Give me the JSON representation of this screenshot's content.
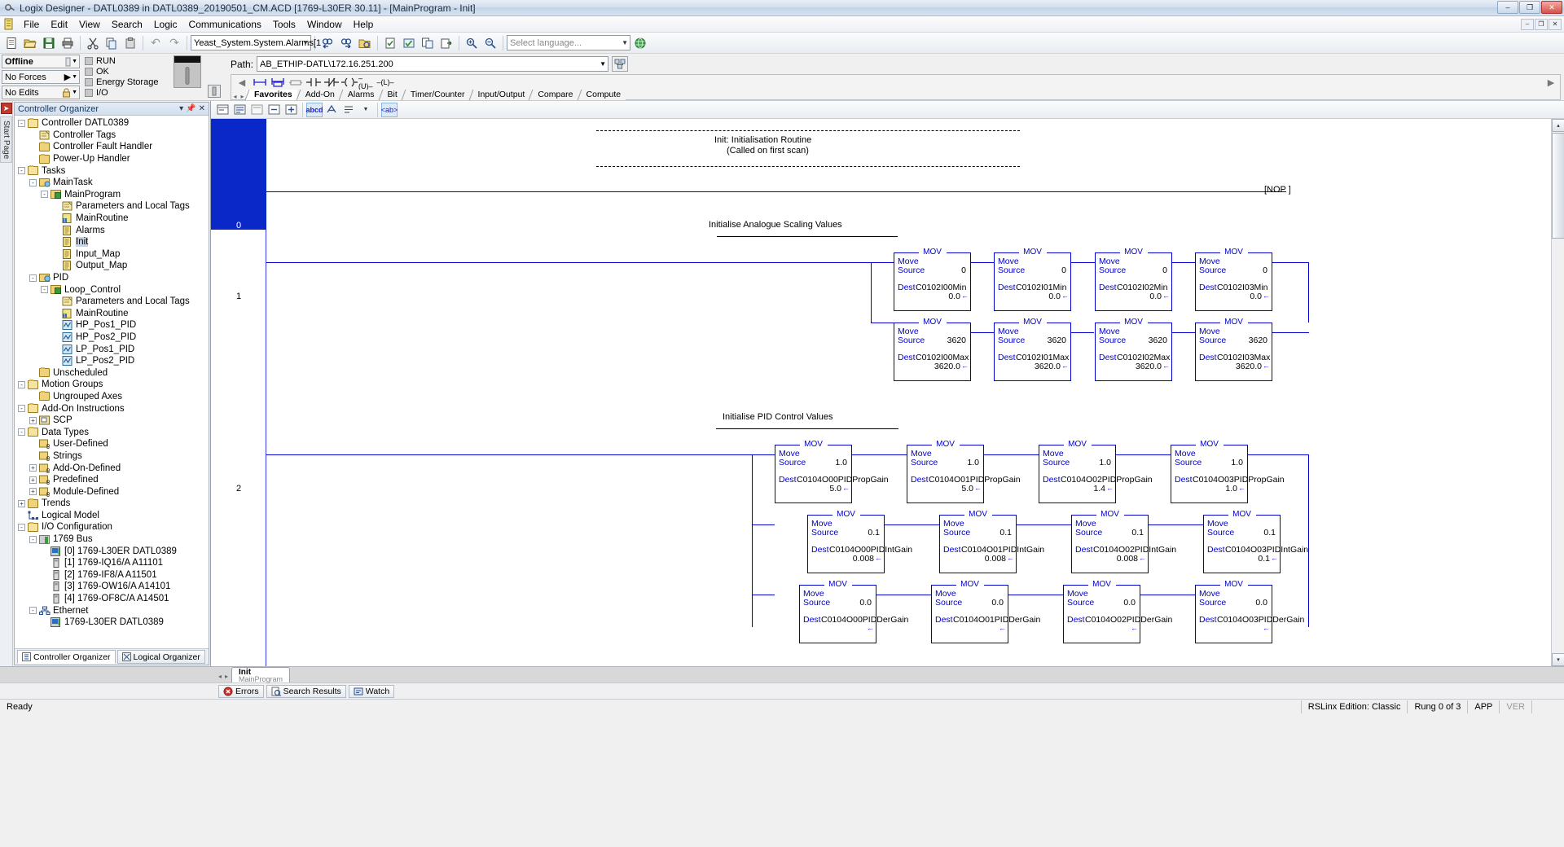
{
  "window": {
    "title": "Logix Designer - DATL0389 in DATL0389_20190501_CM.ACD [1769-L30ER 30.11] - [MainProgram - Init]",
    "app_icon": "logix-icon",
    "minimize": "–",
    "maximize": "❐",
    "close": "✕",
    "doc_restore": "❐",
    "doc_minimize": "–",
    "doc_close": "✕"
  },
  "menu": {
    "doc_icon": "document-icon",
    "items": [
      "File",
      "Edit",
      "View",
      "Search",
      "Logic",
      "Communications",
      "Tools",
      "Window",
      "Help"
    ]
  },
  "toolbar": {
    "buttons": [
      {
        "name": "new-file",
        "glyph": "🗋"
      },
      {
        "name": "open-file",
        "glyph": "📂"
      },
      {
        "name": "save-file",
        "glyph": "💾"
      },
      {
        "name": "print",
        "glyph": "🖶"
      },
      {
        "name": "cut",
        "glyph": "✂"
      },
      {
        "name": "copy",
        "glyph": "⧉"
      },
      {
        "name": "paste",
        "glyph": "📋"
      },
      {
        "name": "undo",
        "glyph": "↶"
      },
      {
        "name": "redo",
        "glyph": "↷"
      }
    ],
    "tag_value": "Yeast_System.System.Alarms[1",
    "language_placeholder": "Select language...",
    "after_buttons": [
      {
        "name": "find-prev",
        "glyph": "🔍"
      },
      {
        "name": "find-next",
        "glyph": "🔎"
      },
      {
        "name": "browse-tags",
        "glyph": "🗂"
      },
      {
        "name": "verify-routine",
        "glyph": "☑"
      },
      {
        "name": "verify-controller",
        "glyph": "✓"
      },
      {
        "name": "cross-reference",
        "glyph": "⧉"
      },
      {
        "name": "export",
        "glyph": "⭳"
      },
      {
        "name": "zoom-in",
        "glyph": "⌕"
      },
      {
        "name": "zoom-out",
        "glyph": "⌕"
      }
    ],
    "help_glyph": "?"
  },
  "online": {
    "mode": "Offline",
    "forces": "No Forces",
    "edits": "No Edits",
    "leds": [
      "RUN",
      "OK",
      "Energy Storage",
      "I/O"
    ],
    "path_label": "Path:",
    "path_value": "AB_ETHIP-DATL\\172.16.251.200"
  },
  "instruction_bar": {
    "glyphs": [
      "◂",
      "⊢⊣",
      "⧼⧽",
      "▭",
      "┤├",
      "┤/├",
      "─( )─",
      "─(U)─",
      "─(L)─"
    ],
    "scroll_right": "▸",
    "tabs": [
      "Favorites",
      "Add-On",
      "Alarms",
      "Bit",
      "Timer/Counter",
      "Input/Output",
      "Compare",
      "Compute"
    ],
    "active_tab": "Favorites",
    "nav_left": "◂",
    "nav_right": "▸"
  },
  "organizer": {
    "side_tab": "Start Page",
    "side_icon": "red-arrow-icon",
    "title": "Controller Organizer",
    "ctrl_down": "▾",
    "ctrl_pin": "⚓",
    "ctrl_close": "✕",
    "tree": [
      {
        "indent": 0,
        "exp": "-",
        "icon": "folder-open-icon",
        "label": "Controller DATL0389",
        "selected": false
      },
      {
        "indent": 1,
        "exp": "",
        "icon": "tags-icon",
        "label": "Controller Tags",
        "selected": false
      },
      {
        "indent": 1,
        "exp": "",
        "icon": "folder-icon",
        "label": "Controller Fault Handler",
        "selected": false
      },
      {
        "indent": 1,
        "exp": "",
        "icon": "folder-icon",
        "label": "Power-Up Handler",
        "selected": false
      },
      {
        "indent": 0,
        "exp": "-",
        "icon": "folder-open-icon",
        "label": "Tasks",
        "selected": false
      },
      {
        "indent": 1,
        "exp": "-",
        "icon": "task-icon",
        "label": "MainTask",
        "selected": false
      },
      {
        "indent": 2,
        "exp": "-",
        "icon": "program-icon",
        "label": "MainProgram",
        "selected": false
      },
      {
        "indent": 3,
        "exp": "",
        "icon": "tags-icon",
        "label": "Parameters and Local Tags",
        "selected": false
      },
      {
        "indent": 3,
        "exp": "",
        "icon": "main-routine-icon",
        "label": "MainRoutine",
        "selected": false
      },
      {
        "indent": 3,
        "exp": "",
        "icon": "routine-icon",
        "label": "Alarms",
        "selected": false
      },
      {
        "indent": 3,
        "exp": "",
        "icon": "routine-icon",
        "label": "Init",
        "selected": true
      },
      {
        "indent": 3,
        "exp": "",
        "icon": "routine-icon",
        "label": "Input_Map",
        "selected": false
      },
      {
        "indent": 3,
        "exp": "",
        "icon": "routine-icon",
        "label": "Output_Map",
        "selected": false
      },
      {
        "indent": 1,
        "exp": "-",
        "icon": "pid-task-icon",
        "label": "PID",
        "selected": false
      },
      {
        "indent": 2,
        "exp": "-",
        "icon": "program-icon",
        "label": "Loop_Control",
        "selected": false
      },
      {
        "indent": 3,
        "exp": "",
        "icon": "tags-icon",
        "label": "Parameters and Local Tags",
        "selected": false
      },
      {
        "indent": 3,
        "exp": "",
        "icon": "main-routine-icon",
        "label": "MainRoutine",
        "selected": false
      },
      {
        "indent": 3,
        "exp": "",
        "icon": "pid-routine-icon",
        "label": "HP_Pos1_PID",
        "selected": false
      },
      {
        "indent": 3,
        "exp": "",
        "icon": "pid-routine-icon",
        "label": "HP_Pos2_PID",
        "selected": false
      },
      {
        "indent": 3,
        "exp": "",
        "icon": "pid-routine-icon",
        "label": "LP_Pos1_PID",
        "selected": false
      },
      {
        "indent": 3,
        "exp": "",
        "icon": "pid-routine-icon",
        "label": "LP_Pos2_PID",
        "selected": false
      },
      {
        "indent": 1,
        "exp": "",
        "icon": "folder-icon",
        "label": "Unscheduled",
        "selected": false
      },
      {
        "indent": 0,
        "exp": "-",
        "icon": "folder-open-icon",
        "label": "Motion Groups",
        "selected": false
      },
      {
        "indent": 1,
        "exp": "",
        "icon": "folder-icon",
        "label": "Ungrouped Axes",
        "selected": false
      },
      {
        "indent": 0,
        "exp": "-",
        "icon": "folder-open-icon",
        "label": "Add-On Instructions",
        "selected": false
      },
      {
        "indent": 1,
        "exp": "+",
        "icon": "aoi-icon",
        "label": "SCP",
        "selected": false
      },
      {
        "indent": 0,
        "exp": "-",
        "icon": "folder-open-icon",
        "label": "Data Types",
        "selected": false
      },
      {
        "indent": 1,
        "exp": "",
        "icon": "datatype-icon",
        "label": "User-Defined",
        "selected": false
      },
      {
        "indent": 1,
        "exp": "",
        "icon": "datatype-icon",
        "label": "Strings",
        "selected": false
      },
      {
        "indent": 1,
        "exp": "+",
        "icon": "datatype-icon",
        "label": "Add-On-Defined",
        "selected": false
      },
      {
        "indent": 1,
        "exp": "+",
        "icon": "datatype-icon",
        "label": "Predefined",
        "selected": false
      },
      {
        "indent": 1,
        "exp": "+",
        "icon": "datatype-icon",
        "label": "Module-Defined",
        "selected": false
      },
      {
        "indent": 0,
        "exp": "+",
        "icon": "folder-icon",
        "label": "Trends",
        "selected": false
      },
      {
        "indent": 0,
        "exp": "",
        "icon": "logical-model-icon",
        "label": "Logical Model",
        "selected": false
      },
      {
        "indent": 0,
        "exp": "-",
        "icon": "folder-open-icon",
        "label": "I/O Configuration",
        "selected": false
      },
      {
        "indent": 1,
        "exp": "-",
        "icon": "bus-icon",
        "label": "1769 Bus",
        "selected": false
      },
      {
        "indent": 2,
        "exp": "",
        "icon": "controller-module-icon",
        "label": "[0] 1769-L30ER DATL0389",
        "selected": false
      },
      {
        "indent": 2,
        "exp": "",
        "icon": "module-icon",
        "label": "[1] 1769-IQ16/A A11101",
        "selected": false
      },
      {
        "indent": 2,
        "exp": "",
        "icon": "module-icon",
        "label": "[2] 1769-IF8/A A11501",
        "selected": false
      },
      {
        "indent": 2,
        "exp": "",
        "icon": "module-icon",
        "label": "[3] 1769-OW16/A A14101",
        "selected": false
      },
      {
        "indent": 2,
        "exp": "",
        "icon": "module-icon",
        "label": "[4] 1769-OF8C/A A14501",
        "selected": false
      },
      {
        "indent": 1,
        "exp": "-",
        "icon": "ethernet-icon",
        "label": "Ethernet",
        "selected": false
      },
      {
        "indent": 2,
        "exp": "",
        "icon": "controller-module-icon",
        "label": "1769-L30ER DATL0389",
        "selected": false
      }
    ],
    "bottom_tabs": [
      {
        "label": "Controller Organizer",
        "icon": "organizer-icon",
        "active": true
      },
      {
        "label": "Logical Organizer",
        "icon": "logical-icon",
        "active": false
      }
    ]
  },
  "ladder": {
    "toolbar_glyphs": [
      "⊞",
      "⊟",
      "⊠",
      "⊡",
      "⊢",
      "abcd",
      "⮃",
      "⬌",
      "▾",
      "<ab>"
    ],
    "rungs": [
      {
        "number": "0"
      },
      {
        "number": "1"
      },
      {
        "number": "2"
      }
    ],
    "rung0": {
      "line1": "Init: Initialisation Routine",
      "line2": "(Called on first scan)",
      "nop": "[NOP ]"
    },
    "rung1_title": "Initialise Analogue Scaling Values",
    "rung2_title": "Initialise PID Control Values",
    "mov_label": "MOV",
    "move_text": "Move",
    "source_text": "Source",
    "dest_text": "Dest",
    "arrow": "←",
    "blocks_min": [
      {
        "source": "0",
        "dest": "C0102I00Min",
        "value": "0.0"
      },
      {
        "source": "0",
        "dest": "C0102I01Min",
        "value": "0.0"
      },
      {
        "source": "0",
        "dest": "C0102I02Min",
        "value": "0.0"
      },
      {
        "source": "0",
        "dest": "C0102I03Min",
        "value": "0.0"
      }
    ],
    "blocks_max": [
      {
        "source": "3620",
        "dest": "C0102I00Max",
        "value": "3620.0"
      },
      {
        "source": "3620",
        "dest": "C0102I01Max",
        "value": "3620.0"
      },
      {
        "source": "3620",
        "dest": "C0102I02Max",
        "value": "3620.0"
      },
      {
        "source": "3620",
        "dest": "C0102I03Max",
        "value": "3620.0"
      }
    ],
    "blocks_prop": [
      {
        "source": "1.0",
        "dest": "C0104O00PIDPropGain",
        "value": "5.0"
      },
      {
        "source": "1.0",
        "dest": "C0104O01PIDPropGain",
        "value": "5.0"
      },
      {
        "source": "1.0",
        "dest": "C0104O02PIDPropGain",
        "value": "1.4"
      },
      {
        "source": "1.0",
        "dest": "C0104O03PIDPropGain",
        "value": "1.0"
      }
    ],
    "blocks_int": [
      {
        "source": "0.1",
        "dest": "C0104O00PIDIntGain",
        "value": "0.008"
      },
      {
        "source": "0.1",
        "dest": "C0104O01PIDIntGain",
        "value": "0.008"
      },
      {
        "source": "0.1",
        "dest": "C0104O02PIDIntGain",
        "value": "0.008"
      },
      {
        "source": "0.1",
        "dest": "C0104O03PIDIntGain",
        "value": "0.1"
      }
    ],
    "blocks_deriv": [
      {
        "source": "0.0",
        "dest": "C0104O00PIDDerGain",
        "value": ""
      },
      {
        "source": "0.0",
        "dest": "C0104O01PIDDerGain",
        "value": ""
      },
      {
        "source": "0.0",
        "dest": "C0104O02PIDDerGain",
        "value": ""
      },
      {
        "source": "0.0",
        "dest": "C0104O03PIDDerGain",
        "value": ""
      }
    ],
    "scroll": {
      "up": "▴",
      "down": "▾",
      "left": "◂",
      "right": "▸"
    }
  },
  "routine_tab": {
    "name": "Init",
    "program": "MainProgram",
    "nav_left": "◂",
    "nav_right": "▸"
  },
  "result_tabs": [
    {
      "label": "Errors",
      "icon": "error-icon"
    },
    {
      "label": "Search Results",
      "icon": "search-results-icon"
    },
    {
      "label": "Watch",
      "icon": "watch-icon"
    }
  ],
  "statusbar": {
    "ready": "Ready",
    "rslinx": "RSLinx Edition: Classic",
    "rung": "Rung 0 of 3",
    "app": "APP",
    "ver": "VER"
  },
  "colors": {
    "ladder_blue": "#0000cc",
    "selection_blue": "#0a28c8",
    "tree_select": "#c9d4e3"
  }
}
